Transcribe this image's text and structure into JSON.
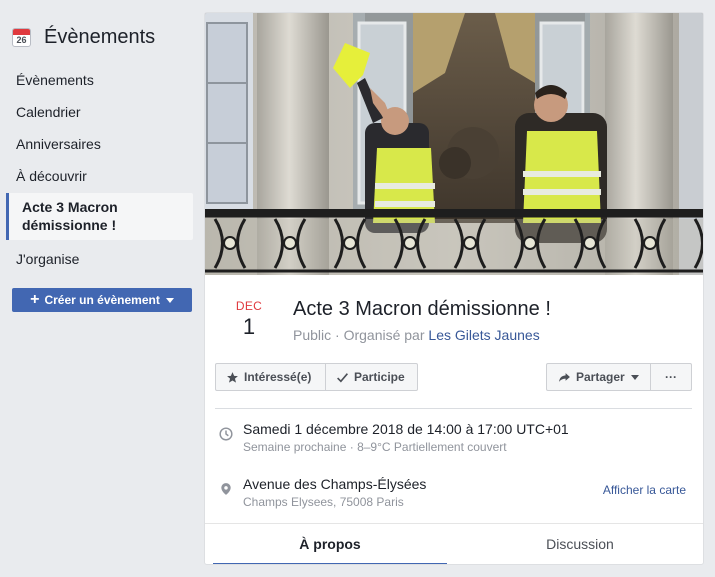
{
  "sidebar": {
    "title": "Évènements",
    "calendar_day": "26",
    "items": [
      {
        "label": "Évènements"
      },
      {
        "label": "Calendrier"
      },
      {
        "label": "Anniversaires"
      },
      {
        "label": "À découvrir"
      },
      {
        "label": "Acte 3 Macron démissionne !"
      },
      {
        "label": "J'organise"
      }
    ],
    "create_button": "Créer un évènement"
  },
  "event": {
    "month": "DEC",
    "day": "1",
    "title": "Acte 3 Macron démissionne !",
    "privacy": "Public · Organisé par",
    "organizer": "Les Gilets Jaunes",
    "buttons": {
      "interested": "Intéressé(e)",
      "participate": "Participe",
      "share": "Partager",
      "more": "···"
    },
    "when": {
      "main": "Samedi 1 décembre 2018 de 14:00 à 17:00 UTC+01",
      "sub": "Semaine prochaine · 8–9°C Partiellement couvert"
    },
    "where": {
      "main": "Avenue des Champs-Élysées",
      "sub": "Champs Elysees, 75008 Paris",
      "map_link": "Afficher la carte"
    },
    "tabs": [
      {
        "label": "À propos"
      },
      {
        "label": "Discussion"
      }
    ]
  },
  "colors": {
    "accent": "#4267b2",
    "month_red": "#e0393e",
    "link": "#385898",
    "vest_yellow": "#d8e84a"
  }
}
